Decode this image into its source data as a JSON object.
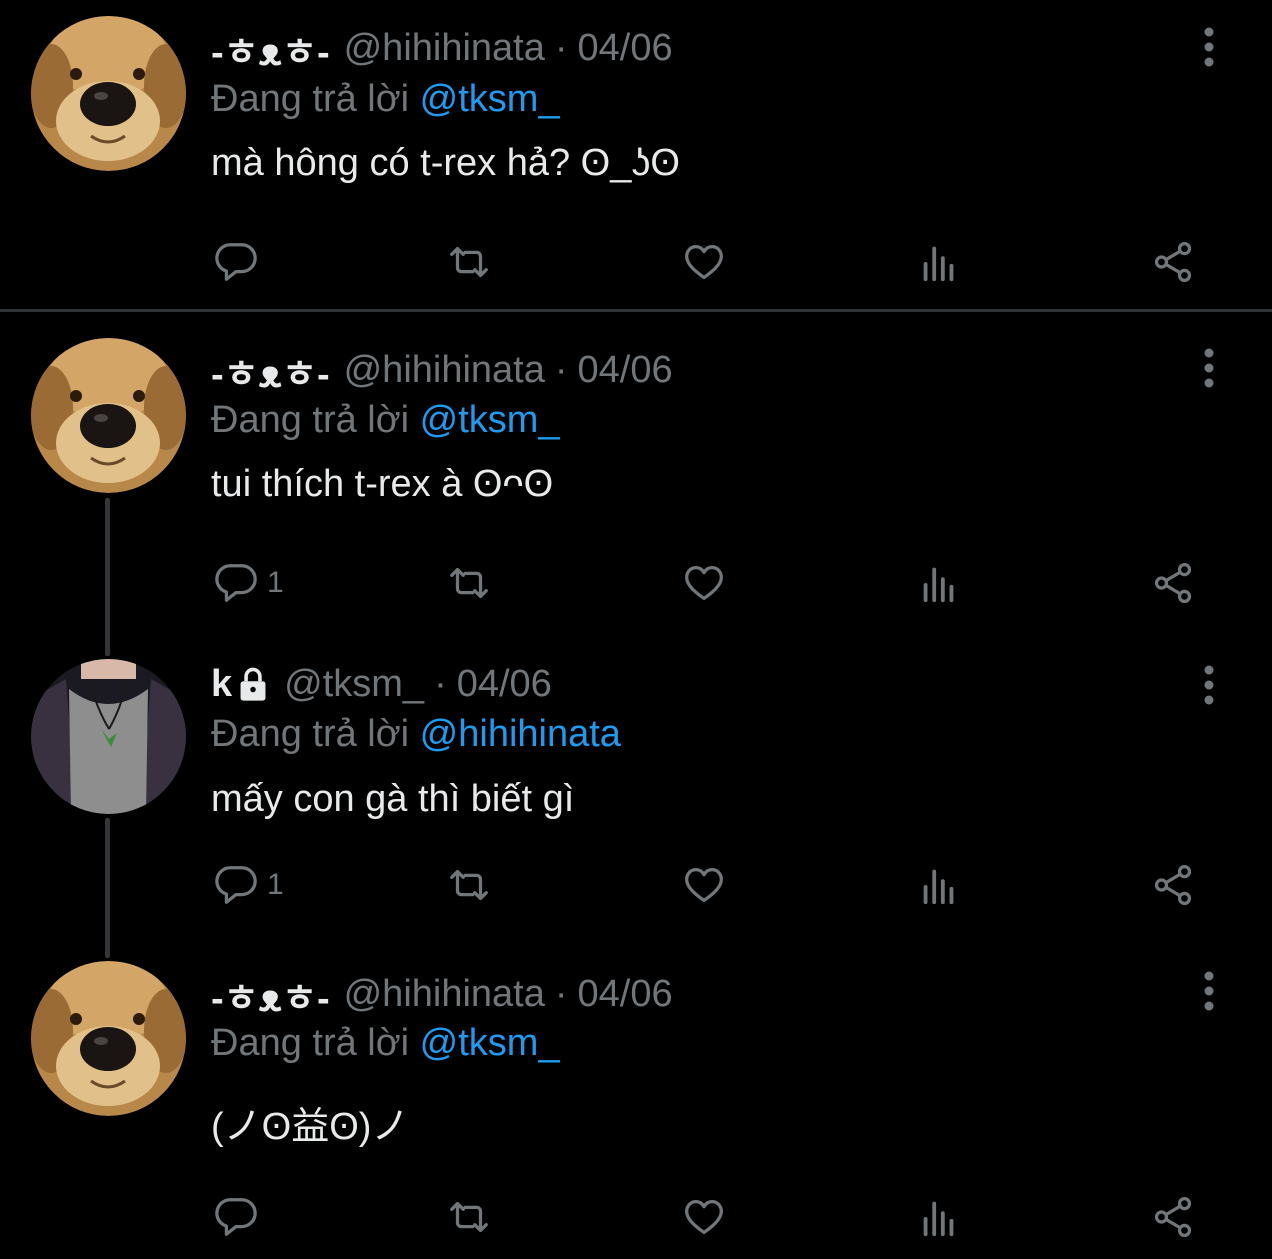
{
  "colors": {
    "background": "#000000",
    "text": "#e7e9ea",
    "muted": "#71767b",
    "link": "#1d9bf0",
    "divider": "#2f3336",
    "thread_line": "#333639"
  },
  "icons": {
    "reply": "reply-icon",
    "retweet": "retweet-icon",
    "like": "heart-icon",
    "views": "analytics-icon",
    "share": "share-icon",
    "more": "more-vertical-icon",
    "protected": "lock-icon"
  },
  "tweets": [
    {
      "display_name": "-ㅎᴥㅎ-",
      "handle": "@hihihinata",
      "separator": "·",
      "date": "04/06",
      "replying_prefix": "Đang trả lời",
      "replying_to": "@tksm_",
      "text": "mà hông có t-rex hả? ʘ_ʖʘ",
      "reply_count": ""
    },
    {
      "display_name": "-ㅎᴥㅎ-",
      "handle": "@hihihinata",
      "separator": "·",
      "date": "04/06",
      "replying_prefix": "Đang trả lời",
      "replying_to": "@tksm_",
      "text": "tui thích t-rex à ʘᴖʘ",
      "reply_count": "1"
    },
    {
      "display_name": "k",
      "handle": "@tksm_",
      "separator": "·",
      "date": "04/06",
      "replying_prefix": "Đang trả lời",
      "replying_to": "@hihihinata",
      "text": "mấy con gà thì biết gì",
      "reply_count": "1"
    },
    {
      "display_name": "-ㅎᴥㅎ-",
      "handle": "@hihihinata",
      "separator": "·",
      "date": "04/06",
      "replying_prefix": "Đang trả lời",
      "replying_to": "@tksm_",
      "text": "(ノʘ益ʘ)ノ",
      "reply_count": ""
    }
  ]
}
